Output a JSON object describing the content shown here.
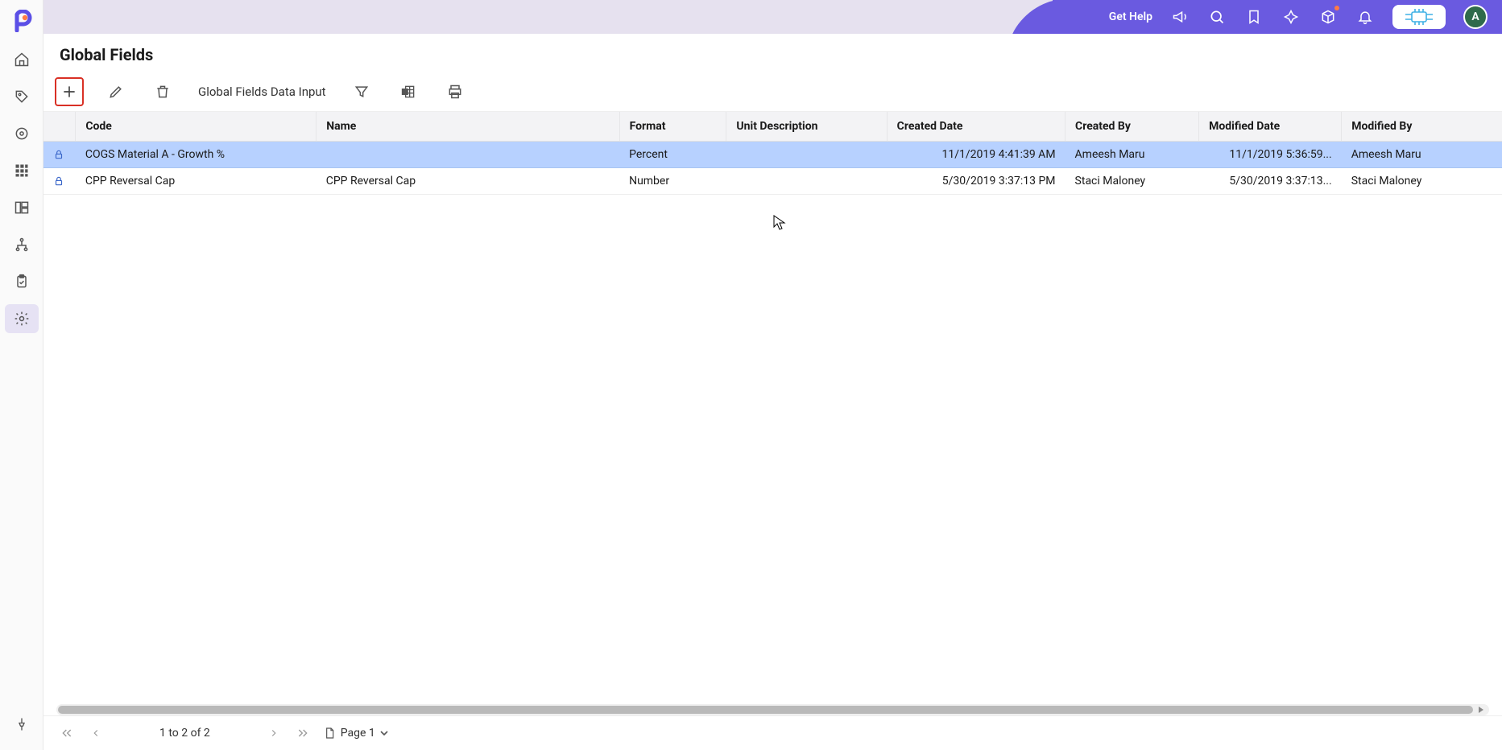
{
  "header": {
    "get_help": "Get Help",
    "avatar_initial": "A"
  },
  "page": {
    "title": "Global Fields"
  },
  "toolbar": {
    "data_input_label": "Global Fields Data Input"
  },
  "table": {
    "columns": {
      "code": "Code",
      "name": "Name",
      "format": "Format",
      "unit_description": "Unit Description",
      "created_date": "Created Date",
      "created_by": "Created By",
      "modified_date": "Modified Date",
      "modified_by": "Modified By"
    },
    "rows": [
      {
        "code": "COGS Material A - Growth %",
        "name": "",
        "format": "Percent",
        "unit_description": "",
        "created_date": "11/1/2019 4:41:39 AM",
        "created_by": "Ameesh Maru",
        "modified_date": "11/1/2019 5:36:59...",
        "modified_by": "Ameesh Maru",
        "selected": true
      },
      {
        "code": "CPP Reversal Cap",
        "name": "CPP Reversal Cap",
        "format": "Number",
        "unit_description": "",
        "created_date": "5/30/2019 3:37:13 PM",
        "created_by": "Staci Maloney",
        "modified_date": "5/30/2019 3:37:13...",
        "modified_by": "Staci Maloney",
        "selected": false
      }
    ]
  },
  "footer": {
    "range": "1 to 2 of 2",
    "page_label": "Page 1"
  }
}
